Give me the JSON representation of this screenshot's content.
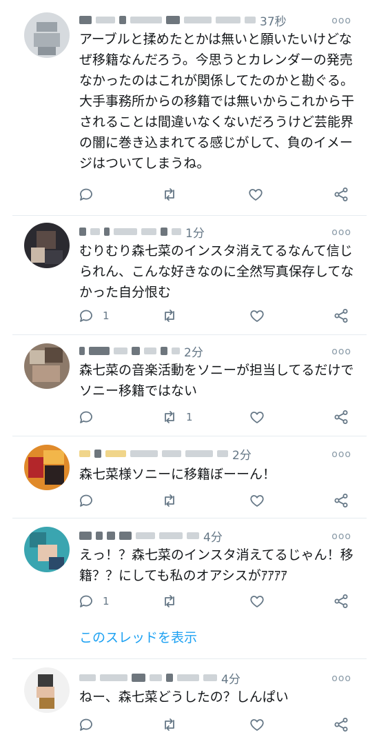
{
  "icons": {
    "reply": "reply-icon",
    "retweet": "retweet-icon",
    "like": "heart-icon",
    "share": "share-icon",
    "more": "more-options-icon"
  },
  "tweets": [
    {
      "time": "37秒",
      "text": "アーブルと揉めたとかは無いと願いたいけどなぜ移籍なんだろう。今思うとカレンダーの発売なかったのはこれが関係してたのかと勘ぐる。大手事務所からの移籍では無いからこれから干されることは間違いなくないだろうけど芸能界の闇に巻き込まれてる感じがして、負のイメージはついてしまうね。",
      "reply_count": "",
      "retweet_count": ""
    },
    {
      "time": "1分",
      "text": "むりむり森七菜のインスタ消えてるなんて信じられん、こんな好きなのに全然写真保存してなかった自分恨む",
      "reply_count": "1",
      "retweet_count": ""
    },
    {
      "time": "2分",
      "text": "森七菜の音楽活動をソニーが担当してるだけでソニー移籍ではない",
      "reply_count": "",
      "retweet_count": "1"
    },
    {
      "time": "2分",
      "text": "森七菜様ソニーに移籍ぼーーん！",
      "reply_count": "",
      "retweet_count": ""
    },
    {
      "time": "4分",
      "text": "えっ！？森七菜のインスタ消えてるじゃん！移籍？？にしても私のオアシスがｱｱｱｱ",
      "reply_count": "1",
      "retweet_count": ""
    },
    {
      "time": "4分",
      "text": "ねー、森七菜どうしたの？しんぱい",
      "reply_count": "",
      "retweet_count": ""
    }
  ],
  "show_thread_label": "このスレッドを表示",
  "more_label": "ooo"
}
